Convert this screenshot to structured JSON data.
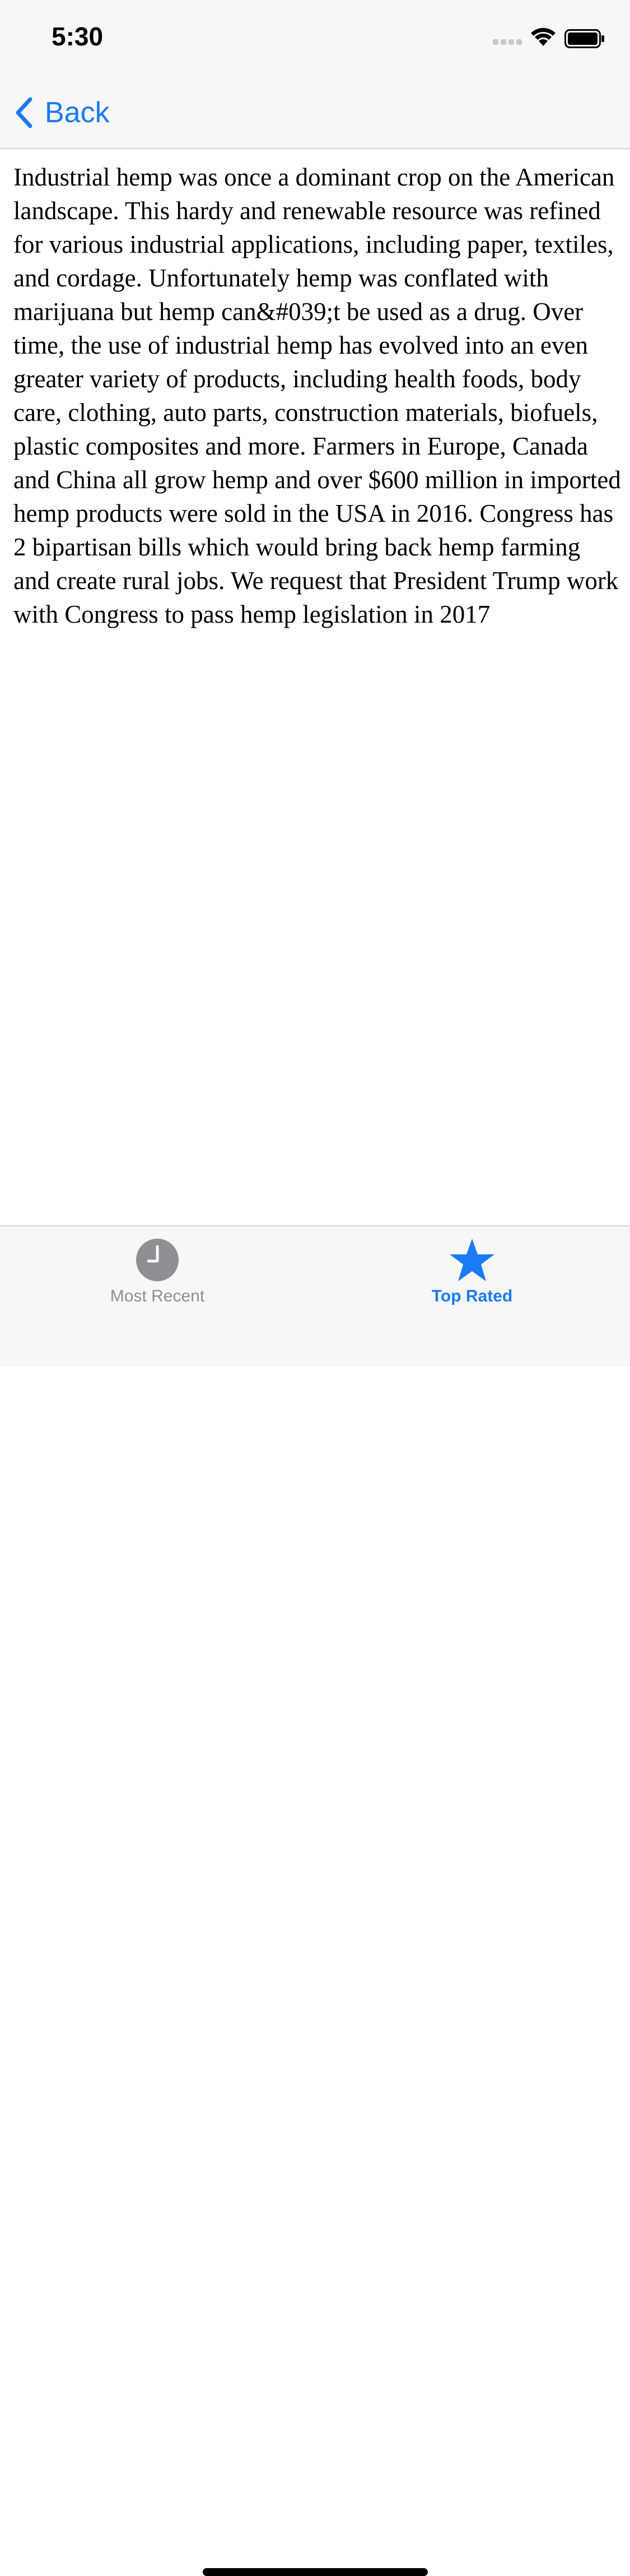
{
  "status_bar": {
    "time": "5:30",
    "signal_icon": "cellular-signal-icon",
    "wifi_icon": "wifi-icon",
    "battery_icon": "battery-icon"
  },
  "nav": {
    "back_label": "Back",
    "back_icon": "chevron-left-icon"
  },
  "content": {
    "body": "Industrial hemp was once a dominant crop on the American landscape. This hardy and renewable resource was refined for various industrial applications, including paper, textiles, and cordage. Unfortunately hemp was conflated with marijuana but hemp can&#039;t be used as a drug. Over time, the use of industrial hemp has evolved into an even greater variety of products, including health foods, body care, clothing, auto parts, construction materials, biofuels, plastic composites and more. Farmers in Europe, Canada and China all grow hemp and over $600 million in imported hemp products were sold in the USA in 2016. Congress has 2 bipartisan bills which would bring back hemp farming and create rural jobs. We request that President Trump work with Congress to pass hemp legislation in 2017"
  },
  "tab_bar": {
    "tabs": [
      {
        "label": "Most Recent",
        "icon": "clock-icon",
        "selected": false
      },
      {
        "label": "Top Rated",
        "icon": "star-icon",
        "selected": true
      }
    ]
  },
  "colors": {
    "accent": "#1a7bf2",
    "inactive": "#8e8e93",
    "bar_background": "#f7f7f7"
  }
}
